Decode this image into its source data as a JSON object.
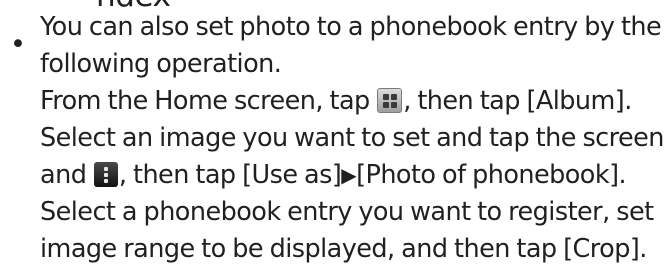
{
  "top_fragment": "ndex",
  "bullet": "•",
  "lines": [
    {
      "text": "You can also set photo to a phonebook entry by the"
    },
    {
      "text": "following operation."
    },
    {
      "before": "From the Home screen, tap ",
      "icon": "apps-grid-icon",
      "after": ", then tap [Album]."
    },
    {
      "text": "Select an image you want to set and tap the screen"
    },
    {
      "before": "and ",
      "icon": "menu-kebab-icon",
      "after_a": ", then tap [Use as]",
      "arrow": "▶",
      "after_b": "[Photo of phonebook]."
    },
    {
      "text": "Select a phonebook entry you want to register, set"
    },
    {
      "text": "image range to be displayed, and then tap [Crop]."
    }
  ]
}
